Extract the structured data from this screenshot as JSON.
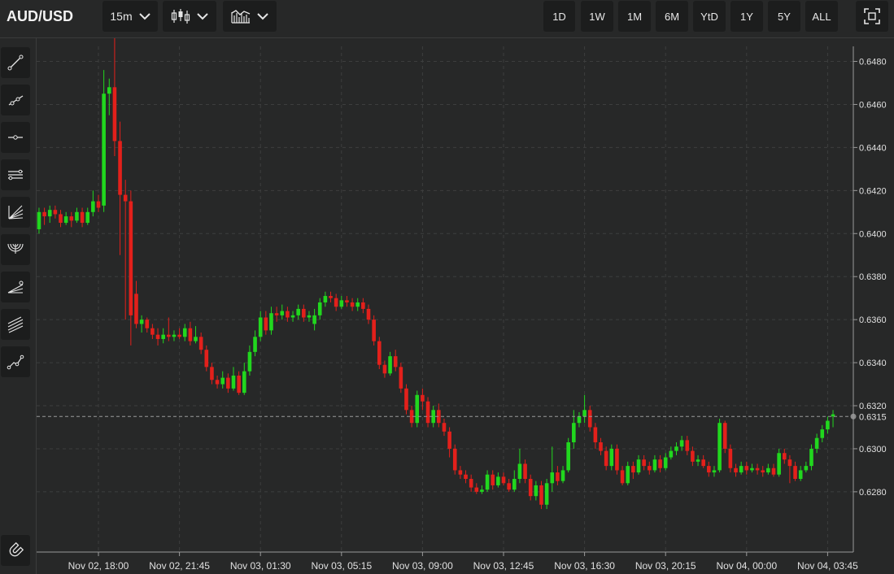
{
  "symbol": "AUD/USD",
  "interval": "15m",
  "ranges": [
    "1D",
    "1W",
    "1M",
    "6M",
    "YtD",
    "1Y",
    "5Y",
    "ALL"
  ],
  "icons": {
    "chart_type": "candlestick-icon",
    "indicators": "indicators-icon",
    "fullscreen": "fullscreen-icon",
    "dropdown": "chevron-down-icon",
    "magnet": "magnet-icon"
  },
  "tools": [
    "trend-line-icon",
    "ray-icon",
    "horizontal-line-icon",
    "parallel-channel-icon",
    "fib-fan-icon",
    "fib-arc-icon",
    "pitchfork-icon",
    "fib-channel-icon",
    "polyline-icon"
  ],
  "colors": {
    "up": "#21d71e",
    "down": "#e3201b",
    "background": "#272828",
    "grid": "#3a3b3b"
  },
  "chart_data": {
    "type": "candlestick",
    "x_ticks": [
      "Nov 02, 18:00",
      "Nov 02, 21:45",
      "Nov 03, 01:30",
      "Nov 03, 05:15",
      "Nov 03, 09:00",
      "Nov 03, 12:45",
      "Nov 03, 16:30",
      "Nov 03, 20:15",
      "Nov 04, 00:00",
      "Nov 04, 03:45"
    ],
    "y_ticks": [
      "0.6280",
      "0.6300",
      "0.6320",
      "0.6340",
      "0.6360",
      "0.6380",
      "0.6400",
      "0.6420",
      "0.6440",
      "0.6460",
      "0.6480"
    ],
    "ylim": [
      0.6252,
      0.6487
    ],
    "last_price": "0.6315",
    "candles": [
      [
        0.6402,
        0.641,
        0.6412,
        0.64
      ],
      [
        0.641,
        0.6408,
        0.6412,
        0.6404
      ],
      [
        0.6408,
        0.6411,
        0.6413,
        0.6405
      ],
      [
        0.6411,
        0.6409,
        0.6413,
        0.6407
      ],
      [
        0.6409,
        0.6405,
        0.6411,
        0.6403
      ],
      [
        0.6405,
        0.6408,
        0.641,
        0.6404
      ],
      [
        0.6408,
        0.6406,
        0.641,
        0.6403
      ],
      [
        0.6406,
        0.641,
        0.6412,
        0.6405
      ],
      [
        0.641,
        0.6405,
        0.6412,
        0.6403
      ],
      [
        0.6405,
        0.641,
        0.6412,
        0.6404
      ],
      [
        0.641,
        0.6415,
        0.642,
        0.6408
      ],
      [
        0.6415,
        0.6412,
        0.6418,
        0.641
      ],
      [
        0.6413,
        0.6465,
        0.6476,
        0.641
      ],
      [
        0.6465,
        0.6468,
        0.6472,
        0.6455
      ],
      [
        0.6468,
        0.6443,
        0.6492,
        0.6436
      ],
      [
        0.6443,
        0.6418,
        0.6452,
        0.639
      ],
      [
        0.6418,
        0.6415,
        0.6425,
        0.636
      ],
      [
        0.6415,
        0.6362,
        0.642,
        0.6348
      ],
      [
        0.6372,
        0.6358,
        0.6378,
        0.6356
      ],
      [
        0.6358,
        0.636,
        0.6362,
        0.6354
      ],
      [
        0.636,
        0.6356,
        0.6361,
        0.6354
      ],
      [
        0.6356,
        0.6353,
        0.6358,
        0.6351
      ],
      [
        0.6353,
        0.6351,
        0.6356,
        0.6348
      ],
      [
        0.6351,
        0.6353,
        0.6356,
        0.6349
      ],
      [
        0.6353,
        0.6352,
        0.6361,
        0.635
      ],
      [
        0.6352,
        0.6353,
        0.6355,
        0.635
      ],
      [
        0.6353,
        0.6352,
        0.6356,
        0.6351
      ],
      [
        0.6352,
        0.6356,
        0.6358,
        0.635
      ],
      [
        0.6356,
        0.635,
        0.6359,
        0.6348
      ],
      [
        0.635,
        0.6352,
        0.6357,
        0.6349
      ],
      [
        0.6352,
        0.6346,
        0.6354,
        0.6344
      ],
      [
        0.6346,
        0.6338,
        0.6348,
        0.6336
      ],
      [
        0.6338,
        0.6332,
        0.634,
        0.633
      ],
      [
        0.6332,
        0.633,
        0.6334,
        0.6328
      ],
      [
        0.633,
        0.6333,
        0.6336,
        0.6328
      ],
      [
        0.6333,
        0.6328,
        0.6335,
        0.6326
      ],
      [
        0.6328,
        0.6334,
        0.6338,
        0.6327
      ],
      [
        0.6334,
        0.6326,
        0.6336,
        0.6325
      ],
      [
        0.6326,
        0.6336,
        0.634,
        0.6325
      ],
      [
        0.6336,
        0.6345,
        0.6348,
        0.6334
      ],
      [
        0.6345,
        0.6352,
        0.6355,
        0.6343
      ],
      [
        0.6352,
        0.6361,
        0.6364,
        0.635
      ],
      [
        0.6361,
        0.6355,
        0.6364,
        0.6353
      ],
      [
        0.6355,
        0.6363,
        0.6366,
        0.6353
      ],
      [
        0.6363,
        0.6362,
        0.6366,
        0.6359
      ],
      [
        0.6362,
        0.6364,
        0.6367,
        0.636
      ],
      [
        0.6364,
        0.6361,
        0.6366,
        0.6359
      ],
      [
        0.6361,
        0.6362,
        0.6364,
        0.6359
      ],
      [
        0.6362,
        0.6365,
        0.6367,
        0.636
      ],
      [
        0.6365,
        0.6361,
        0.6367,
        0.6359
      ],
      [
        0.6361,
        0.6362,
        0.6364,
        0.6359
      ],
      [
        0.6358,
        0.6362,
        0.6365,
        0.6355
      ],
      [
        0.6362,
        0.6368,
        0.637,
        0.636
      ],
      [
        0.6368,
        0.6371,
        0.6373,
        0.6366
      ],
      [
        0.6371,
        0.637,
        0.6373,
        0.6368
      ],
      [
        0.637,
        0.6366,
        0.6372,
        0.6364
      ],
      [
        0.6366,
        0.6369,
        0.6371,
        0.6365
      ],
      [
        0.6369,
        0.6368,
        0.6371,
        0.6366
      ],
      [
        0.6368,
        0.6366,
        0.637,
        0.6364
      ],
      [
        0.6366,
        0.6368,
        0.637,
        0.6364
      ],
      [
        0.6368,
        0.6365,
        0.637,
        0.6363
      ],
      [
        0.6365,
        0.636,
        0.6367,
        0.6358
      ],
      [
        0.636,
        0.635,
        0.6362,
        0.6348
      ],
      [
        0.635,
        0.6339,
        0.6352,
        0.6337
      ],
      [
        0.6339,
        0.6335,
        0.6341,
        0.6333
      ],
      [
        0.6335,
        0.6343,
        0.6345,
        0.6334
      ],
      [
        0.6343,
        0.6338,
        0.6346,
        0.6336
      ],
      [
        0.6338,
        0.6328,
        0.634,
        0.6326
      ],
      [
        0.6328,
        0.6318,
        0.633,
        0.6316
      ],
      [
        0.6318,
        0.6312,
        0.632,
        0.631
      ],
      [
        0.6312,
        0.6325,
        0.6327,
        0.631
      ],
      [
        0.6325,
        0.6322,
        0.6328,
        0.6318
      ],
      [
        0.6322,
        0.6312,
        0.6324,
        0.631
      ],
      [
        0.6312,
        0.6318,
        0.632,
        0.631
      ],
      [
        0.6318,
        0.6312,
        0.6321,
        0.631
      ],
      [
        0.6312,
        0.6308,
        0.6314,
        0.6306
      ],
      [
        0.6308,
        0.63,
        0.631,
        0.6296
      ],
      [
        0.63,
        0.629,
        0.6302,
        0.6288
      ],
      [
        0.629,
        0.6288,
        0.6292,
        0.6286
      ],
      [
        0.6288,
        0.6286,
        0.629,
        0.6284
      ],
      [
        0.6286,
        0.6282,
        0.6288,
        0.628
      ],
      [
        0.6282,
        0.628,
        0.6284,
        0.6279
      ],
      [
        0.628,
        0.6281,
        0.6283,
        0.6279
      ],
      [
        0.6281,
        0.6288,
        0.629,
        0.628
      ],
      [
        0.6288,
        0.6283,
        0.629,
        0.6281
      ],
      [
        0.6283,
        0.6287,
        0.6289,
        0.6282
      ],
      [
        0.6287,
        0.6284,
        0.6289,
        0.6283
      ],
      [
        0.6284,
        0.6281,
        0.6286,
        0.628
      ],
      [
        0.6281,
        0.6286,
        0.629,
        0.628
      ],
      [
        0.6286,
        0.6293,
        0.63,
        0.6284
      ],
      [
        0.6293,
        0.6286,
        0.6295,
        0.6284
      ],
      [
        0.6286,
        0.6278,
        0.6288,
        0.6276
      ],
      [
        0.6278,
        0.6283,
        0.6285,
        0.6276
      ],
      [
        0.6283,
        0.6274,
        0.6285,
        0.6272
      ],
      [
        0.6274,
        0.6284,
        0.6286,
        0.6272
      ],
      [
        0.6284,
        0.6289,
        0.6301,
        0.628
      ],
      [
        0.6289,
        0.6285,
        0.6292,
        0.6283
      ],
      [
        0.6285,
        0.629,
        0.6292,
        0.6284
      ],
      [
        0.629,
        0.6303,
        0.6305,
        0.6289
      ],
      [
        0.6303,
        0.6312,
        0.6318,
        0.63
      ],
      [
        0.6312,
        0.6315,
        0.6317,
        0.631
      ],
      [
        0.6315,
        0.6318,
        0.6325,
        0.6312
      ],
      [
        0.6318,
        0.631,
        0.632,
        0.6308
      ],
      [
        0.631,
        0.6303,
        0.6312,
        0.63
      ],
      [
        0.6303,
        0.6299,
        0.6305,
        0.6297
      ],
      [
        0.6299,
        0.6292,
        0.6301,
        0.629
      ],
      [
        0.6292,
        0.63,
        0.6302,
        0.629
      ],
      [
        0.63,
        0.629,
        0.6302,
        0.6288
      ],
      [
        0.629,
        0.6284,
        0.6292,
        0.6283
      ],
      [
        0.6284,
        0.6292,
        0.6294,
        0.6283
      ],
      [
        0.6292,
        0.6289,
        0.6294,
        0.6286
      ],
      [
        0.6289,
        0.6295,
        0.6297,
        0.6288
      ],
      [
        0.6295,
        0.6292,
        0.6297,
        0.629
      ],
      [
        0.6292,
        0.629,
        0.6294,
        0.6288
      ],
      [
        0.629,
        0.6295,
        0.6297,
        0.6289
      ],
      [
        0.6295,
        0.6291,
        0.6297,
        0.6289
      ],
      [
        0.6291,
        0.6296,
        0.6298,
        0.629
      ],
      [
        0.6296,
        0.6299,
        0.6301,
        0.6295
      ],
      [
        0.6299,
        0.6301,
        0.6303,
        0.6297
      ],
      [
        0.6301,
        0.6304,
        0.6306,
        0.6299
      ],
      [
        0.6304,
        0.6299,
        0.6306,
        0.6297
      ],
      [
        0.6299,
        0.6294,
        0.6301,
        0.6292
      ],
      [
        0.6294,
        0.6295,
        0.6297,
        0.6292
      ],
      [
        0.6295,
        0.6292,
        0.6297,
        0.6291
      ],
      [
        0.6292,
        0.6289,
        0.6294,
        0.6287
      ],
      [
        0.6289,
        0.629,
        0.6292,
        0.6287
      ],
      [
        0.629,
        0.6312,
        0.6314,
        0.6289
      ],
      [
        0.6312,
        0.63,
        0.6313,
        0.6298
      ],
      [
        0.63,
        0.6291,
        0.6302,
        0.6289
      ],
      [
        0.6291,
        0.6289,
        0.6293,
        0.6287
      ],
      [
        0.6289,
        0.6292,
        0.6294,
        0.6288
      ],
      [
        0.6292,
        0.629,
        0.6294,
        0.6288
      ],
      [
        0.629,
        0.6291,
        0.6293,
        0.6289
      ],
      [
        0.6291,
        0.629,
        0.6293,
        0.6288
      ],
      [
        0.629,
        0.6289,
        0.6292,
        0.6287
      ],
      [
        0.6289,
        0.6291,
        0.6293,
        0.6288
      ],
      [
        0.6291,
        0.6288,
        0.6293,
        0.6287
      ],
      [
        0.6288,
        0.6298,
        0.63,
        0.6287
      ],
      [
        0.6298,
        0.6295,
        0.63,
        0.6293
      ],
      [
        0.6295,
        0.6292,
        0.6297,
        0.6284
      ],
      [
        0.6292,
        0.6286,
        0.6294,
        0.6285
      ],
      [
        0.6286,
        0.629,
        0.6292,
        0.6285
      ],
      [
        0.629,
        0.6292,
        0.6294,
        0.6289
      ],
      [
        0.6292,
        0.63,
        0.6302,
        0.629
      ],
      [
        0.63,
        0.6305,
        0.6307,
        0.6298
      ],
      [
        0.6305,
        0.6309,
        0.6311,
        0.6303
      ],
      [
        0.6309,
        0.6313,
        0.6315,
        0.6307
      ],
      [
        0.6315,
        0.6316,
        0.6318,
        0.631
      ]
    ]
  }
}
